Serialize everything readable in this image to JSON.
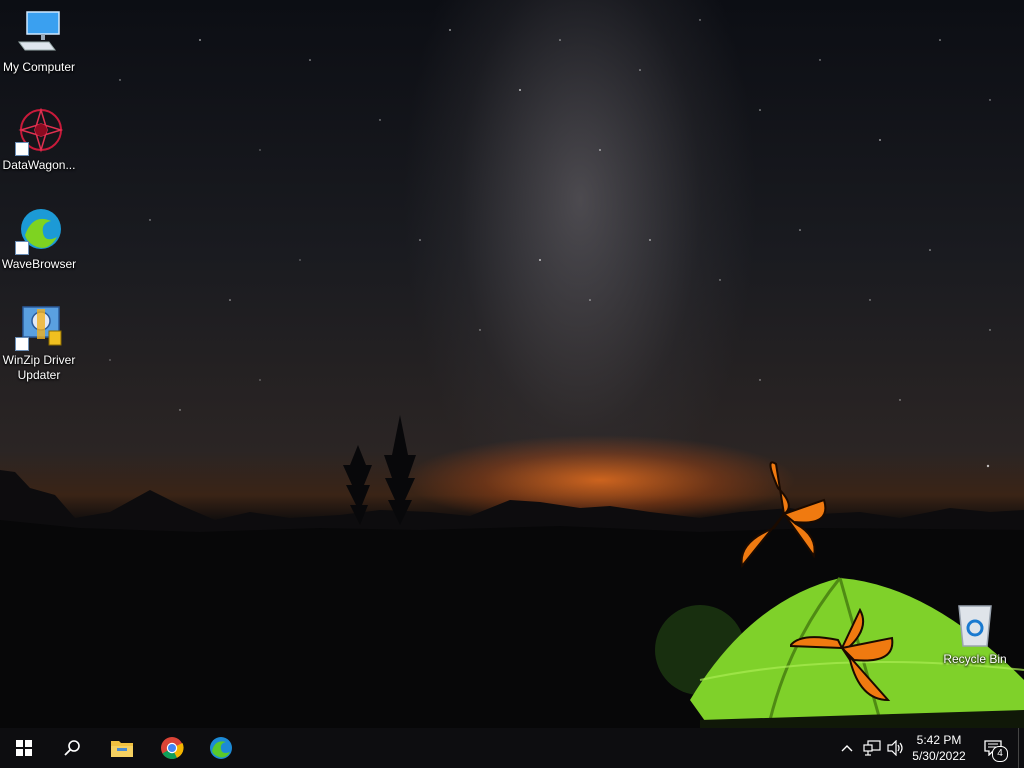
{
  "desktop": {
    "icons": [
      {
        "label": "My Computer",
        "icon": "computer-icon"
      },
      {
        "label": "DataWagon...",
        "icon": "datawagon-icon"
      },
      {
        "label": "WaveBrowser",
        "icon": "wavebrowser-icon"
      },
      {
        "label": "WinZip Driver Updater",
        "icon": "winzip-driver-updater-icon"
      },
      {
        "label": "Recycle Bin",
        "icon": "recycle-bin-icon"
      }
    ]
  },
  "taskbar": {
    "pinned": [
      {
        "name": "start",
        "icon": "windows-start-icon"
      },
      {
        "name": "search",
        "icon": "search-icon"
      },
      {
        "name": "file-explorer",
        "icon": "folder-icon"
      },
      {
        "name": "chrome",
        "icon": "chrome-icon"
      },
      {
        "name": "edge",
        "icon": "edge-icon"
      }
    ],
    "tray": {
      "time": "5:42 PM",
      "date": "5/30/2022",
      "notification_count": "4"
    }
  },
  "colors": {
    "taskbar_bg": "#0d0d10",
    "tent_green": "#7fd12a",
    "butterfly_orange": "#f07a10"
  }
}
